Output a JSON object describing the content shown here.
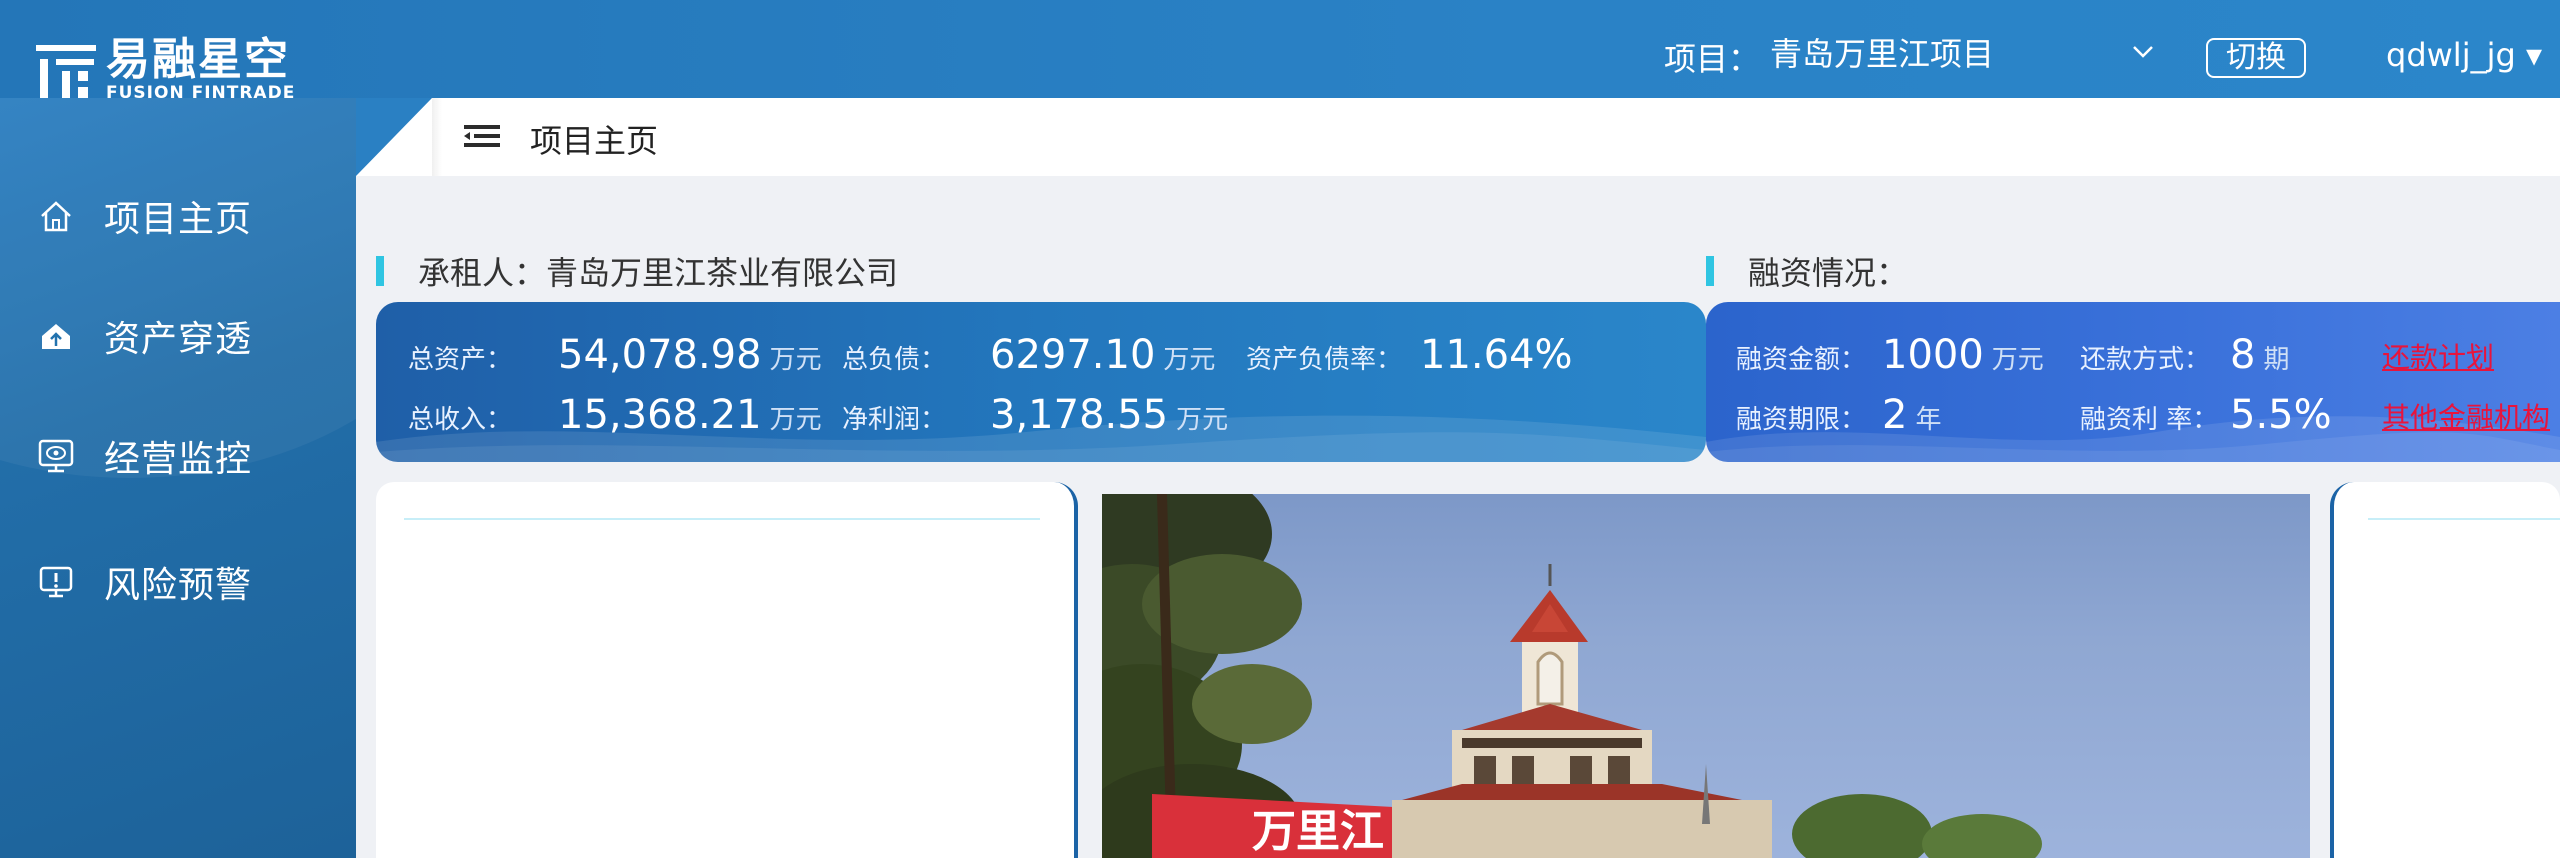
{
  "brand": {
    "name_cn": "易融星空",
    "name_en": "FUSION FINTRADE"
  },
  "header": {
    "project_label": "项目：",
    "project_selected": "青岛万里江项目",
    "switch_label": "切换",
    "user": "qdwlj_jg ▾"
  },
  "sidebar": {
    "items": [
      {
        "label": "项目主页",
        "icon": "home-icon"
      },
      {
        "label": "资产穿透",
        "icon": "house-upload-icon"
      },
      {
        "label": "经营监控",
        "icon": "monitor-eye-icon"
      },
      {
        "label": "风险预警",
        "icon": "alert-screen-icon"
      }
    ]
  },
  "tabs": {
    "current": "项目主页"
  },
  "lessee": {
    "title": "承租人：青岛万里江茶业有限公司",
    "total_assets_label": "总资产：",
    "total_assets": "54,078.98",
    "total_assets_unit": "万元",
    "total_debt_label": "总负债：",
    "total_debt": "6297.10",
    "total_debt_unit": "万元",
    "debt_ratio_label": "资产负债率：",
    "debt_ratio": "11.64%",
    "revenue_label": "总收入：",
    "revenue": "15,368.21",
    "revenue_unit": "万元",
    "net_profit_label": "净利润：",
    "net_profit": "3,178.55",
    "net_profit_unit": "万元"
  },
  "financing": {
    "title": "融资情况：",
    "amount_label": "融资金额：",
    "amount": "1000",
    "amount_unit": "万元",
    "repay_label": "还款方式：",
    "repay": "8",
    "repay_unit": "期",
    "repay_plan_link": "还款计划",
    "term_label": "融资期限：",
    "term": "2",
    "term_unit": "年",
    "rate_label": "融资利 率：",
    "rate": "5.5%",
    "other_link": "其他金融机构"
  },
  "photo": {
    "sign_text": "万里江"
  },
  "colors": {
    "accent": "#2fc5e2",
    "link_red": "#e8143c",
    "top_blue": "#2a80c3"
  }
}
